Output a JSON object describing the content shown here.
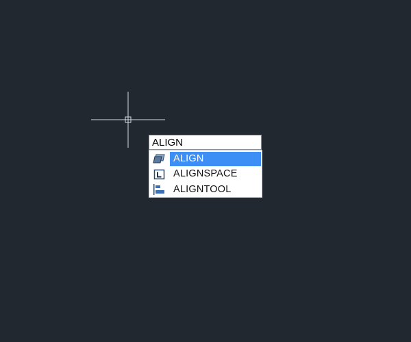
{
  "command_line": {
    "input_value": "ALIGN"
  },
  "suggestions": {
    "items": [
      {
        "label": "ALIGN",
        "icon": "align-3d-icon",
        "selected": true
      },
      {
        "label": "ALIGNSPACE",
        "icon": "align-space-icon",
        "selected": false
      },
      {
        "label": "ALIGNTOOL",
        "icon": "align-tool-icon",
        "selected": false
      }
    ]
  },
  "colors": {
    "canvas_background": "#212830",
    "selection_highlight": "#3d8ff5",
    "crosshair": "#d9dde2"
  }
}
